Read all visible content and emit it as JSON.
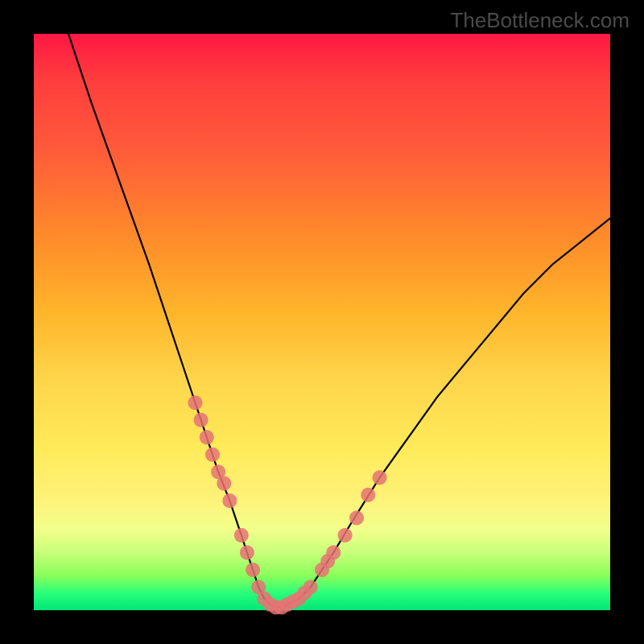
{
  "watermark": "TheBottleneck.com",
  "chart_data": {
    "type": "line",
    "title": "",
    "xlabel": "",
    "ylabel": "",
    "xlim": [
      0,
      100
    ],
    "ylim": [
      0,
      100
    ],
    "grid": false,
    "legend": false,
    "series": [
      {
        "name": "bottleneck-curve",
        "color": "#000000",
        "x": [
          6,
          10,
          15,
          20,
          25,
          28,
          30,
          32,
          34,
          36,
          37,
          38,
          39,
          40,
          41,
          42,
          43,
          44,
          46,
          48,
          50,
          52,
          55,
          60,
          65,
          70,
          75,
          80,
          85,
          90,
          95,
          100
        ],
        "y": [
          100,
          88,
          74,
          60,
          45,
          36,
          30,
          24,
          19,
          13,
          10,
          7,
          4,
          2,
          1,
          0.5,
          0.5,
          1,
          2,
          4,
          7,
          10,
          15,
          23,
          30,
          37,
          43,
          49,
          55,
          60,
          64,
          68
        ]
      },
      {
        "name": "highlight-dots-left",
        "type": "scatter",
        "color": "#e57373",
        "x": [
          28,
          29,
          30,
          31,
          32,
          33,
          34,
          36,
          37
        ],
        "y": [
          36,
          33,
          30,
          27,
          24,
          22,
          19,
          13,
          10
        ]
      },
      {
        "name": "highlight-dots-bottom",
        "type": "scatter",
        "color": "#e57373",
        "x": [
          38,
          39,
          40,
          41,
          42,
          43,
          44,
          45,
          46,
          47,
          48
        ],
        "y": [
          7,
          4,
          2,
          1,
          0.5,
          0.5,
          1,
          1.5,
          2,
          3,
          4
        ]
      },
      {
        "name": "highlight-dots-right",
        "type": "scatter",
        "color": "#e57373",
        "x": [
          50,
          51,
          52,
          54,
          56,
          58,
          60
        ],
        "y": [
          7,
          8.5,
          10,
          13,
          16,
          20,
          23
        ]
      }
    ],
    "annotations": []
  }
}
